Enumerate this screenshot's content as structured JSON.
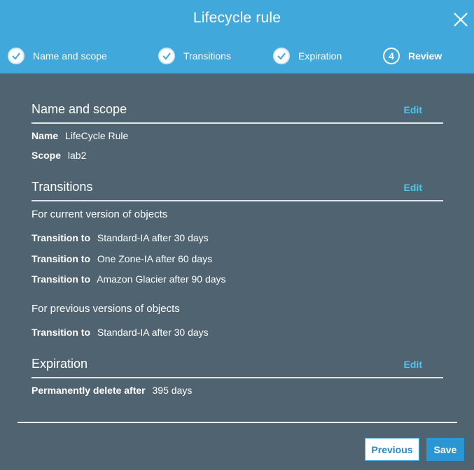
{
  "dialog": {
    "title": "Lifecycle rule"
  },
  "steps": [
    {
      "label": "Name and scope",
      "state": "done"
    },
    {
      "label": "Transitions",
      "state": "done"
    },
    {
      "label": "Expiration",
      "state": "done"
    },
    {
      "label": "Review",
      "state": "current",
      "number": "4"
    }
  ],
  "name_scope": {
    "heading": "Name and scope",
    "edit": "Edit",
    "name_label": "Name",
    "name_value": "LifeCycle Rule",
    "scope_label": "Scope",
    "scope_value": "lab2"
  },
  "transitions": {
    "heading": "Transitions",
    "edit": "Edit",
    "current_heading": "For current version of objects",
    "current": [
      {
        "label": "Transition to",
        "value": "Standard-IA after 30 days"
      },
      {
        "label": "Transition to",
        "value": "One Zone-IA after 60 days"
      },
      {
        "label": "Transition to",
        "value": "Amazon Glacier after 90 days"
      }
    ],
    "previous_heading": "For previous versions of objects",
    "previous": [
      {
        "label": "Transition to",
        "value": "Standard-IA after 30 days"
      }
    ]
  },
  "expiration": {
    "heading": "Expiration",
    "edit": "Edit",
    "delete_label": "Permanently delete after",
    "delete_value": "395 days"
  },
  "footer": {
    "previous_label": "Previous",
    "save_label": "Save"
  },
  "colors": {
    "header": "#41a8dc",
    "body": "#4f6470",
    "accent": "#4fc6ec"
  }
}
